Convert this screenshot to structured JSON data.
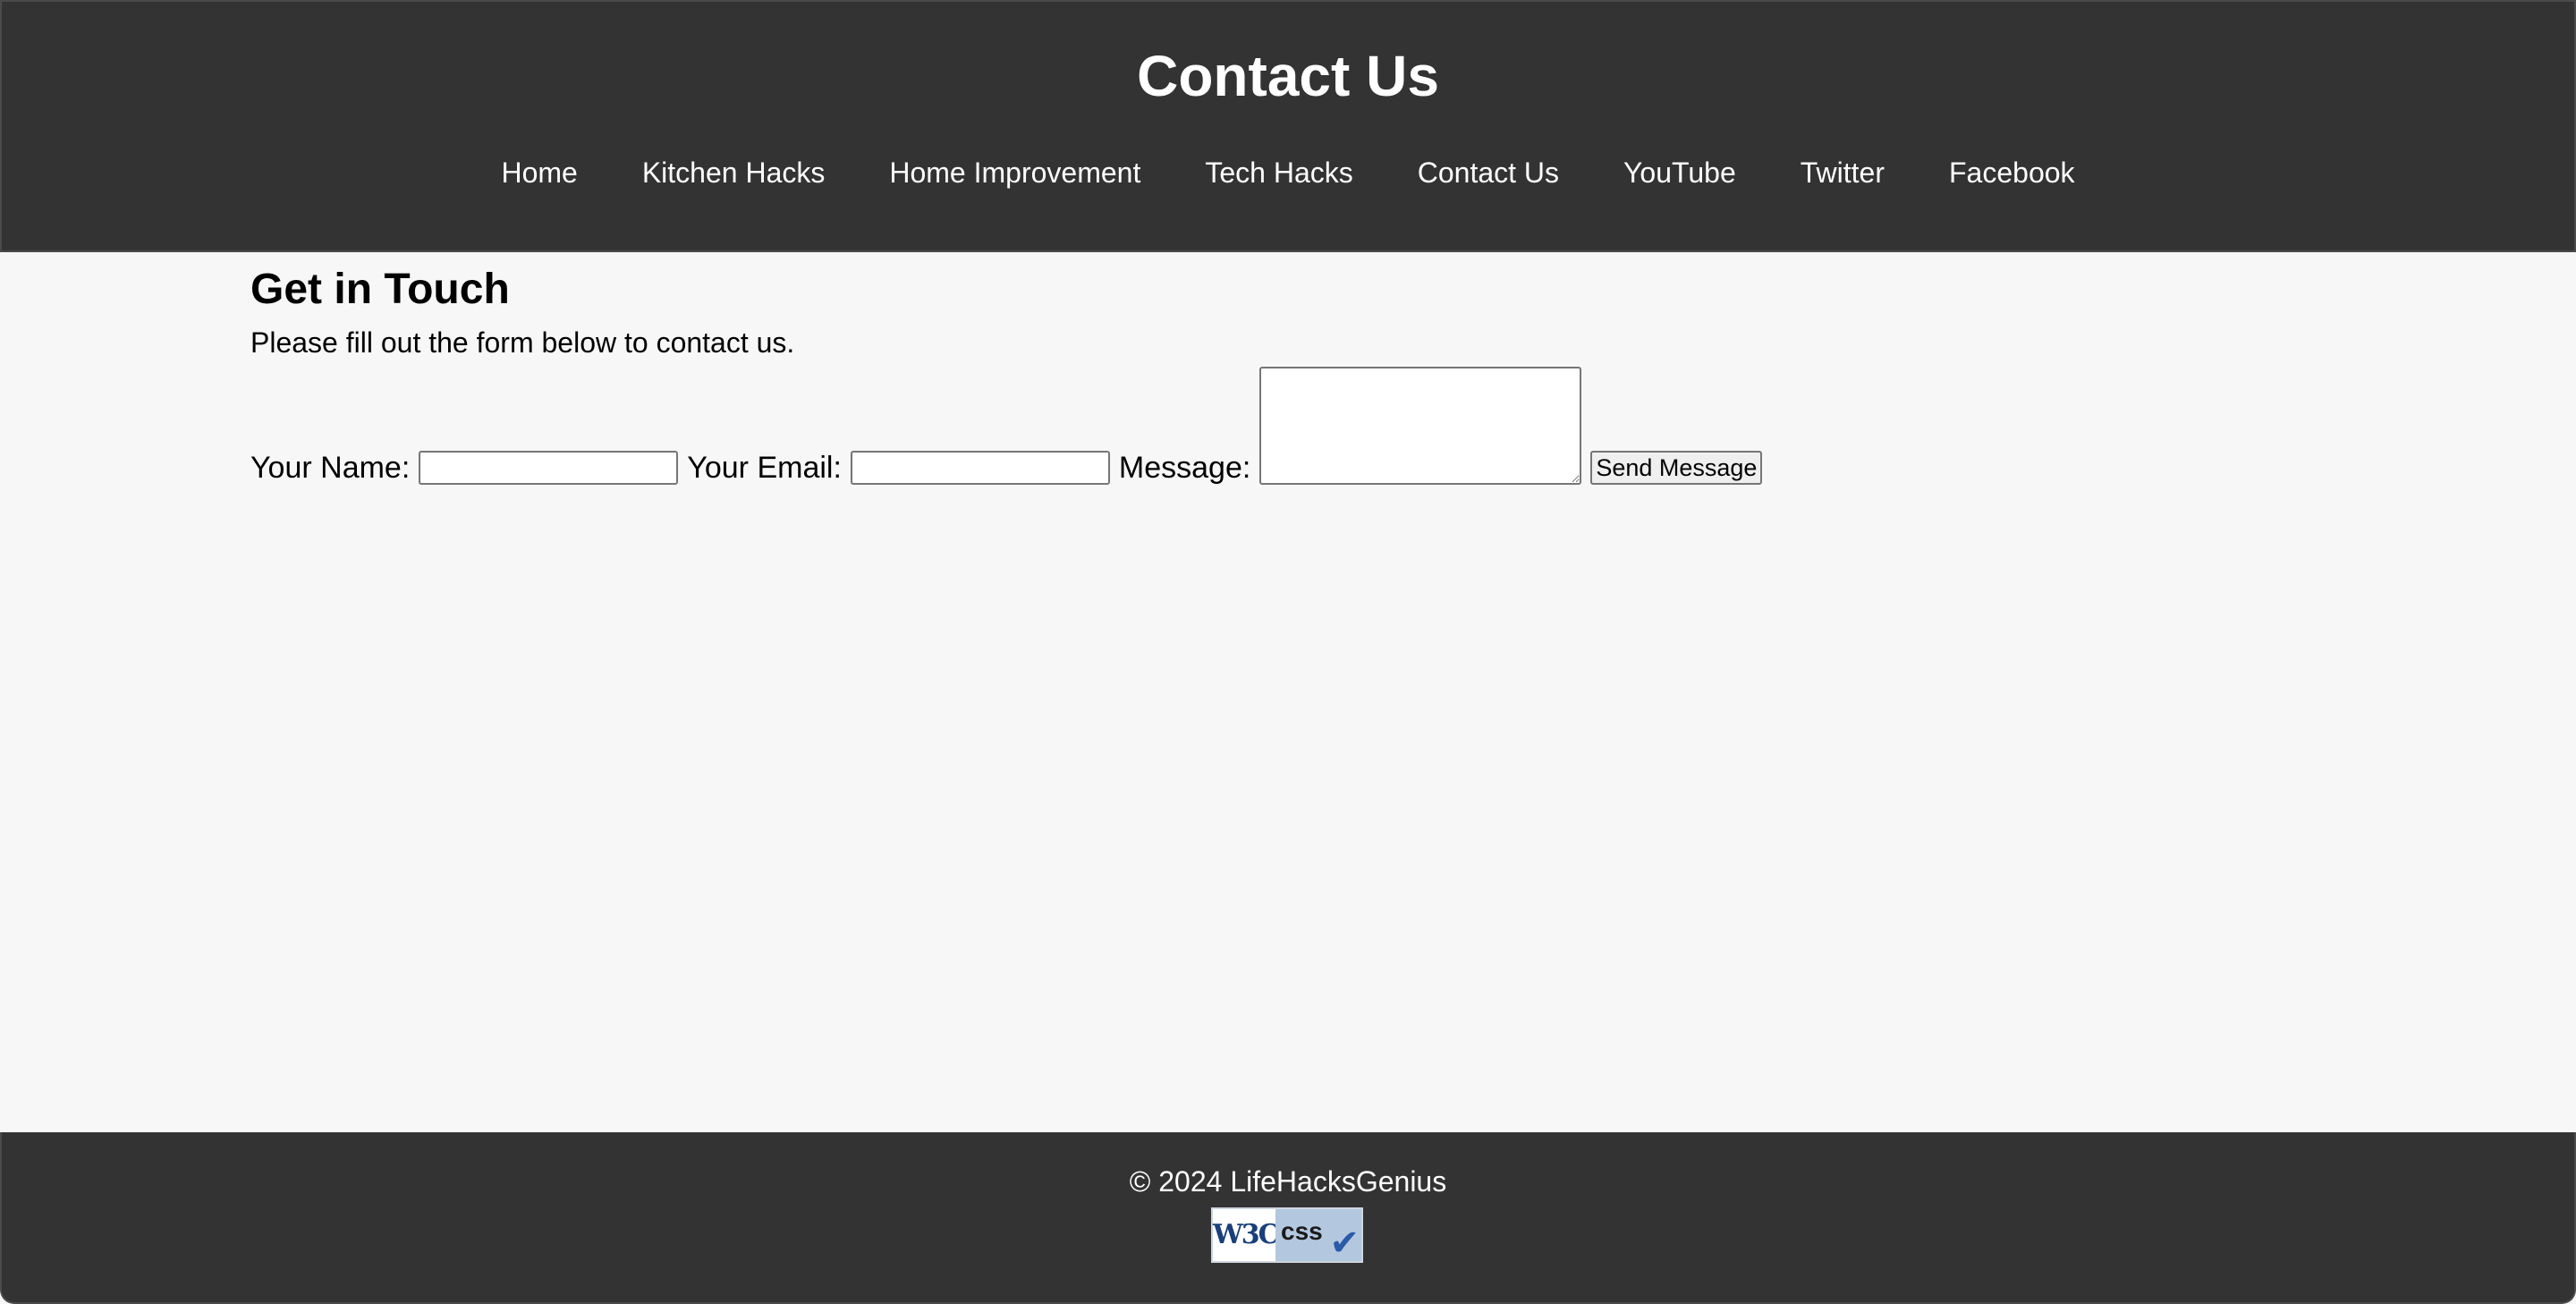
{
  "header": {
    "title": "Contact Us",
    "nav": [
      {
        "label": "Home"
      },
      {
        "label": "Kitchen Hacks"
      },
      {
        "label": "Home Improvement"
      },
      {
        "label": "Tech Hacks"
      },
      {
        "label": "Contact Us"
      },
      {
        "label": "YouTube"
      },
      {
        "label": "Twitter"
      },
      {
        "label": "Facebook"
      }
    ]
  },
  "main": {
    "heading": "Get in Touch",
    "intro": "Please fill out the form below to contact us.",
    "form": {
      "name_label": "Your Name:",
      "name_value": "",
      "email_label": "Your Email:",
      "email_value": "",
      "message_label": "Message:",
      "message_value": "",
      "submit_label": "Send Message"
    }
  },
  "footer": {
    "copyright": "© 2024 LifeHacksGenius",
    "badge": {
      "left_text": "W3C",
      "right_text": "css",
      "icon": "checkmark-icon"
    }
  },
  "colors": {
    "header_bg": "#333333",
    "page_bg": "#f7f7f7",
    "badge_blue": "#2a5aa8"
  }
}
